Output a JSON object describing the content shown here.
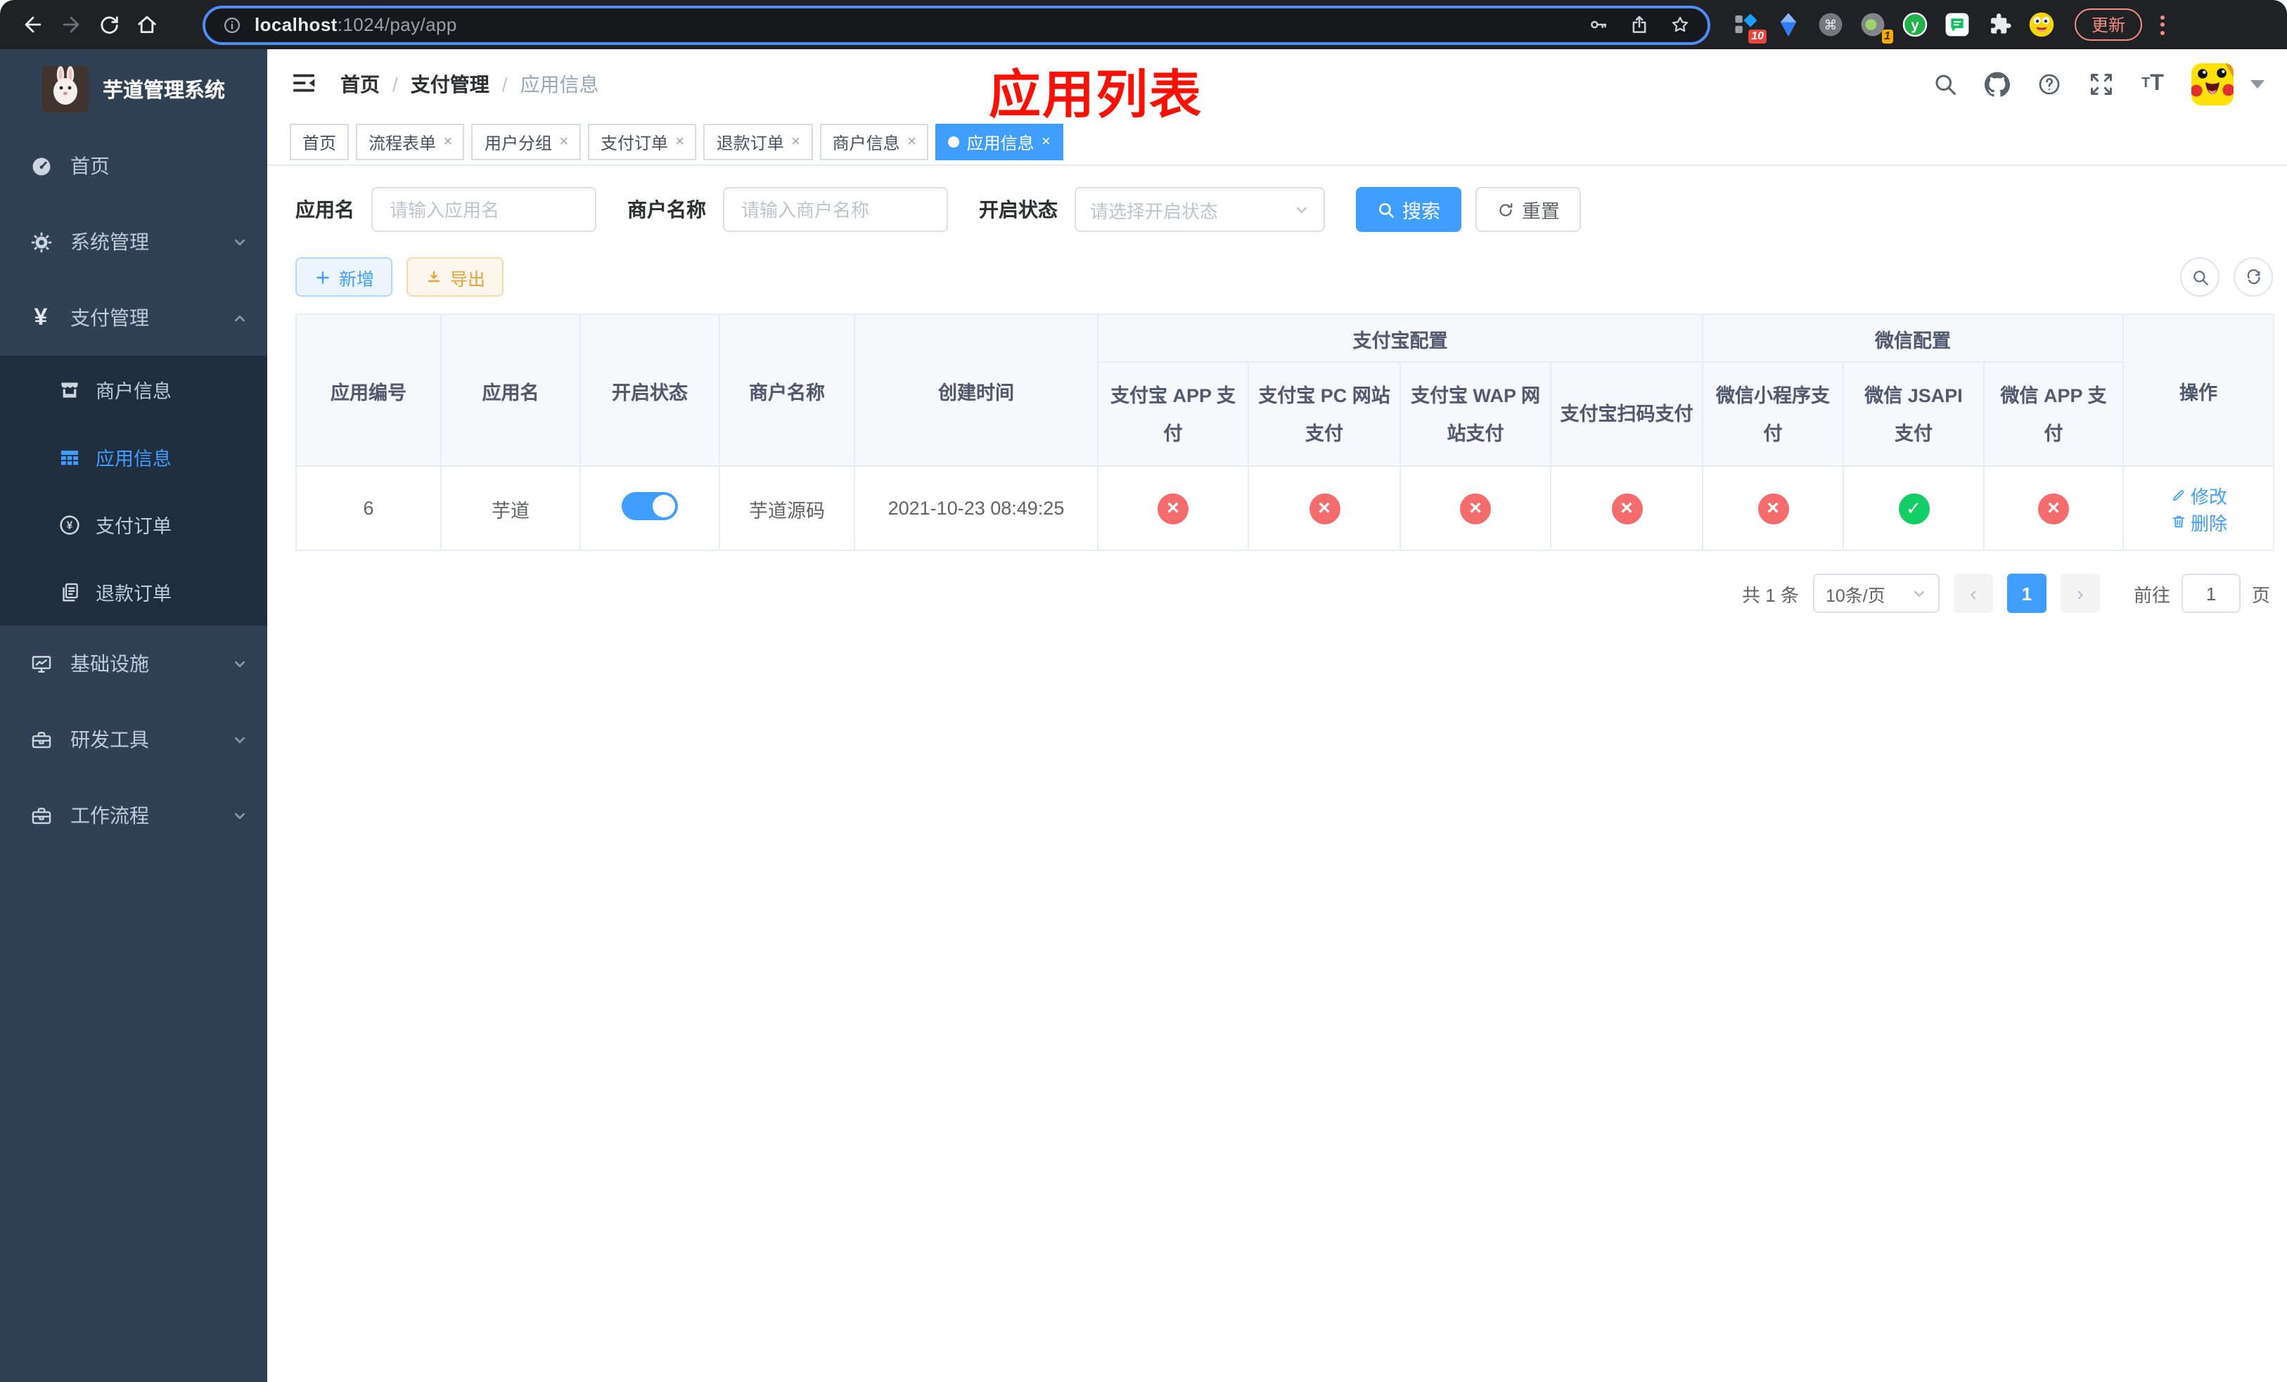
{
  "colors": {
    "primary": "#409eff",
    "success": "#13ce66",
    "danger": "#f56c6c",
    "warning": "#e6a23c",
    "sidebar_bg": "#304156",
    "submenu_bg": "#1f2d3d",
    "annotation_red": "#f81206",
    "chrome_bg": "#202124",
    "update_red": "#f28b82",
    "active_tab_bg": "#409eff"
  },
  "browser": {
    "url_host": "localhost",
    "url_rest": ":1024/pay/app",
    "update_label": "更新",
    "ext1_badge": "10",
    "ext2_badge": "1",
    "ext_y": "y"
  },
  "sidebar": {
    "title": "芋道管理系统",
    "items": [
      {
        "label": "首页"
      },
      {
        "label": "系统管理"
      },
      {
        "label": "支付管理"
      },
      {
        "label": "基础设施"
      },
      {
        "label": "研发工具"
      },
      {
        "label": "工作流程"
      }
    ],
    "submenu": [
      {
        "label": "商户信息"
      },
      {
        "label": "应用信息"
      },
      {
        "label": "支付订单"
      },
      {
        "label": "退款订单"
      }
    ]
  },
  "header": {
    "breadcrumb": [
      "首页",
      "支付管理",
      "应用信息"
    ],
    "separator": "/",
    "annotation": "应用列表"
  },
  "tabs": [
    {
      "label": "首页"
    },
    {
      "label": "流程表单"
    },
    {
      "label": "用户分组"
    },
    {
      "label": "支付订单"
    },
    {
      "label": "退款订单"
    },
    {
      "label": "商户信息"
    },
    {
      "label": "应用信息"
    }
  ],
  "filters": {
    "app_name_label": "应用名",
    "app_name_placeholder": "请输入应用名",
    "merchant_label": "商户名称",
    "merchant_placeholder": "请输入商户名称",
    "status_label": "开启状态",
    "status_placeholder": "请选择开启状态",
    "search_label": "搜索",
    "reset_label": "重置"
  },
  "toolbar": {
    "add_label": "新增",
    "export_label": "导出"
  },
  "table": {
    "headers": {
      "app_id": "应用编号",
      "app_name": "应用名",
      "status": "开启状态",
      "merchant": "商户名称",
      "created": "创建时间",
      "alipay_group": "支付宝配置",
      "wechat_group": "微信配置",
      "alipay_app": "支付宝 APP 支付",
      "alipay_pc": "支付宝 PC 网站支付",
      "alipay_wap": "支付宝 WAP 网站支付",
      "alipay_qr": "支付宝扫码支付",
      "wx_mini": "微信小程序支付",
      "wx_jsapi": "微信 JSAPI 支付",
      "wx_app": "微信 APP 支付",
      "actions": "操作"
    },
    "row": {
      "app_id": "6",
      "app_name": "芋道",
      "status_on": true,
      "merchant": "芋道源码",
      "created": "2021-10-23 08:49:25",
      "configs": [
        "off",
        "off",
        "off",
        "off",
        "off",
        "on",
        "off"
      ],
      "edit_label": "修改",
      "delete_label": "删除"
    }
  },
  "pagination": {
    "total": "共 1 条",
    "page_size": "10条/页",
    "current_page": "1",
    "prev": "‹",
    "next": "›",
    "goto_label": "前往",
    "goto_value": "1",
    "page_unit": "页"
  }
}
